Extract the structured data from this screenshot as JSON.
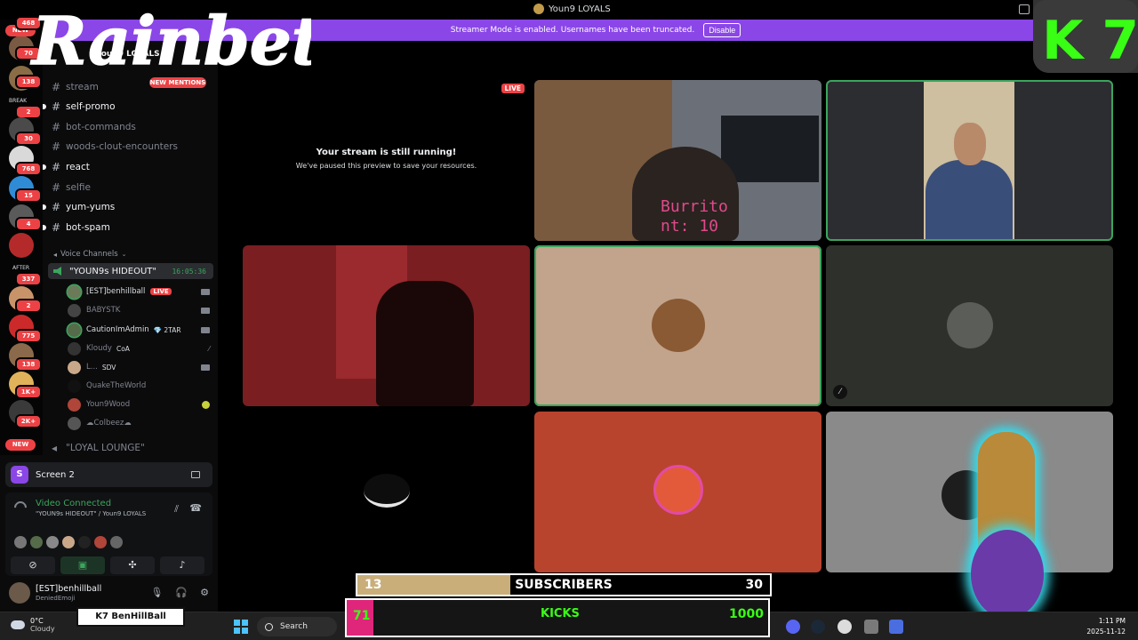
{
  "window": {
    "title": "Youn9 LOYALS"
  },
  "banner": {
    "text": "Streamer Mode is enabled. Usernames have been truncated.",
    "disable_label": "Disable"
  },
  "overlay": {
    "brand": "Rainbet",
    "k7": "K 7",
    "tag": "K7 BenHillBall"
  },
  "rail": {
    "badges": [
      {
        "label": "468"
      },
      {
        "label": "NEW"
      },
      {
        "label": "70"
      },
      {
        "label": "138"
      },
      {
        "label": "BREAK"
      },
      {
        "label": "2"
      },
      {
        "label": "30"
      },
      {
        "label": "768"
      },
      {
        "label": "15"
      },
      {
        "label": "4"
      },
      {
        "label": "AFTER"
      },
      {
        "label": "337"
      },
      {
        "label": "2"
      },
      {
        "label": "775"
      },
      {
        "label": "138"
      },
      {
        "label": "1K+"
      },
      {
        "label": "2K+"
      },
      {
        "label": "NEW"
      }
    ]
  },
  "sidebar": {
    "server_name": "Youn9 LOYALS",
    "new_mentions": "NEW MENTIONS",
    "channels": [
      {
        "name": "stream",
        "unread": false
      },
      {
        "name": "self-promo",
        "unread": true
      },
      {
        "name": "bot-commands",
        "unread": false
      },
      {
        "name": "woods-clout-encounters",
        "unread": false
      },
      {
        "name": "react",
        "unread": true
      },
      {
        "name": "selfie",
        "unread": false
      },
      {
        "name": "yum-yums",
        "unread": true
      },
      {
        "name": "bot-spam",
        "unread": true
      }
    ],
    "voice_category": "Voice Channels",
    "voice_channel": {
      "name": "\"YOUN9s HIDEOUT\"",
      "timer": "16:05:36"
    },
    "voice_users": [
      {
        "name": "[EST]benhillball",
        "live": "LIVE",
        "tag": "",
        "dim": false
      },
      {
        "name": "BABYSTK",
        "live": "",
        "tag": "",
        "dim": true
      },
      {
        "name": "CautionImAdmin",
        "live": "",
        "tag": "💎 2TAR",
        "dim": false
      },
      {
        "name": "Kloudy",
        "live": "",
        "tag": "CoA",
        "dim": true
      },
      {
        "name": "L...",
        "live": "",
        "tag": "SDV",
        "dim": true
      },
      {
        "name": "QuakeTheWorld",
        "live": "",
        "tag": "",
        "dim": true
      },
      {
        "name": "Youn9Wood",
        "live": "",
        "tag": "",
        "dim": true
      },
      {
        "name": "☁Colbeez☁",
        "live": "",
        "tag": "",
        "dim": true
      }
    ],
    "lounge": "\"LOYAL LOUNGE\""
  },
  "panel": {
    "screen_label": "Screen 2",
    "screen_initial": "S",
    "vc_status": "Video Connected",
    "vc_location": "\"YOUN9s HIDEOUT\" / Youn9 LOYALS",
    "me_name": "[EST]benhillball",
    "me_status": "DeniedEmoji"
  },
  "stage": {
    "paused_title": "Your stream is still running!",
    "paused_sub": "We've paused this preview to save your resources.",
    "live_label": "LIVE",
    "overlay_text": "Burrito\nnt: 10"
  },
  "subs": {
    "current": "13",
    "label": "SUBSCRIBERS",
    "goal": "30",
    "progress": 0.37
  },
  "kicks": {
    "left": "71",
    "mid": "KICKS",
    "right": "1000"
  },
  "taskbar": {
    "temp": "0°C",
    "weather": "Cloudy",
    "search": "Search",
    "time": "1:11 PM",
    "date": "2025-11-12"
  }
}
